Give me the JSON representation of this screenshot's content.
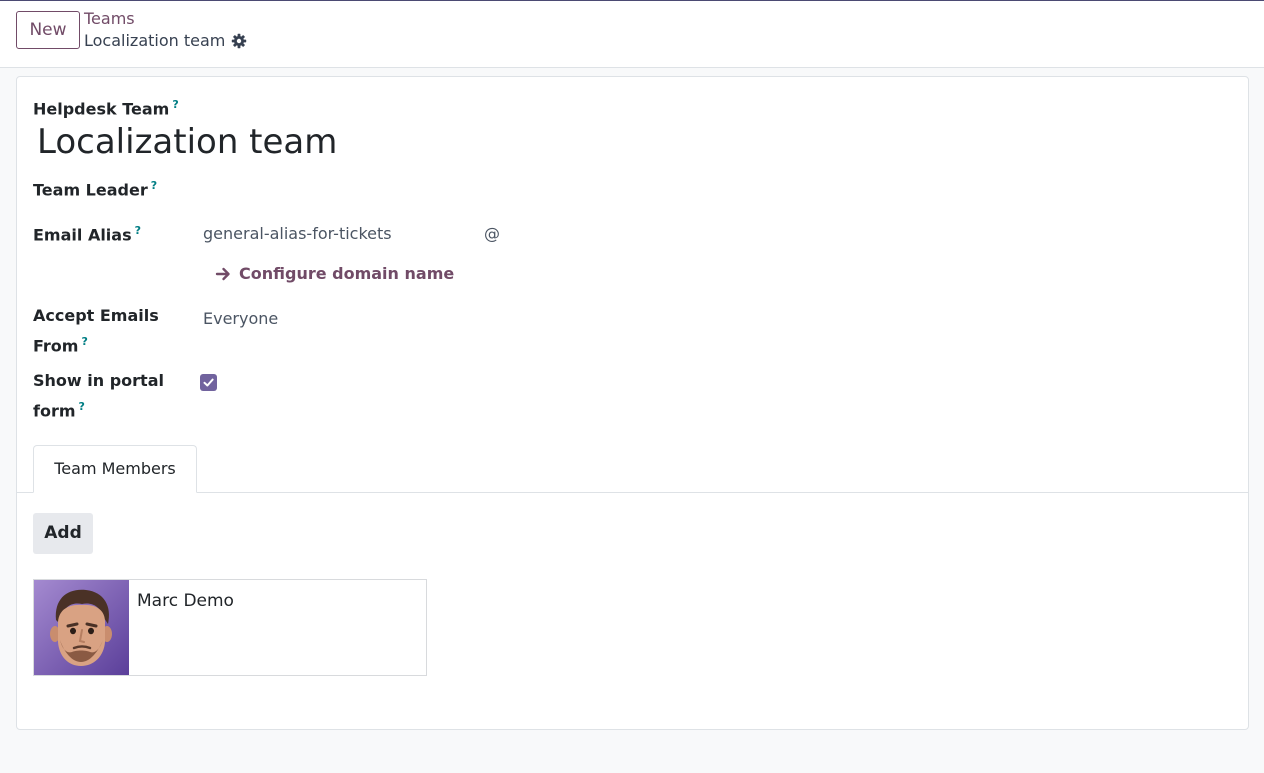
{
  "control_panel": {
    "new_button": "New",
    "breadcrumb_parent": "Teams",
    "breadcrumb_current": "Localization team"
  },
  "form": {
    "team_label": "Helpdesk Team",
    "help_mark": "?",
    "team_name": "Localization team",
    "team_leader_label": "Team Leader",
    "team_leader_value": "",
    "email_alias_label": "Email Alias",
    "email_alias_value": "general-alias-for-tickets",
    "email_alias_at": "@",
    "configure_domain_link": "Configure domain name",
    "accept_emails_label_1": "Accept Emails",
    "accept_emails_label_2": "From",
    "accept_emails_value": "Everyone",
    "show_portal_label_1": "Show in portal",
    "show_portal_label_2": "form",
    "show_portal_checked": true
  },
  "tabs": [
    {
      "label": "Team Members",
      "active": true
    }
  ],
  "members": {
    "add_button": "Add",
    "items": [
      {
        "name": "Marc Demo"
      }
    ]
  },
  "colors": {
    "brand": "#714b67",
    "checkbox": "#71639e",
    "help": "#017e84"
  }
}
